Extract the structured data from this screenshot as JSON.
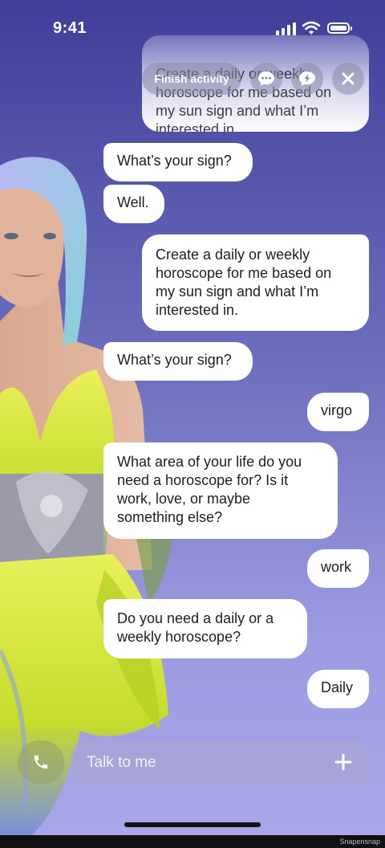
{
  "status_bar": {
    "time": "9:41"
  },
  "header": {
    "finish_label": "Finish activity",
    "icons": [
      "chat-bubble-icon",
      "lightning-bubble-icon",
      "close-icon"
    ],
    "faded_message": "Create a daily or weekly\nhoroscope for me based on\nmy sun sign and what I’m\ninterested in."
  },
  "messages": [
    {
      "sender": "bot",
      "text": "What’s your sign?"
    },
    {
      "sender": "bot",
      "text": "Well."
    },
    {
      "sender": "user",
      "text": "Create a daily or weekly\nhoroscope for me based on\nmy sun sign and what I’m\ninterested in."
    },
    {
      "sender": "bot",
      "text": "What’s your sign?"
    },
    {
      "sender": "user",
      "text": "virgo"
    },
    {
      "sender": "bot",
      "text": "What area of your life do you\nneed a horoscope for? Is it\nwork, love, or maybe\nsomething else?"
    },
    {
      "sender": "user",
      "text": "work"
    },
    {
      "sender": "bot",
      "text": "Do you need a daily or a\nweekly horoscope?"
    },
    {
      "sender": "user",
      "text": "Daily"
    }
  ],
  "composer": {
    "placeholder": "Talk to me",
    "value": "",
    "call_icon": "phone-icon",
    "add_icon": "plus-icon"
  },
  "footer": {
    "watermark": "Snapensnap"
  },
  "colors": {
    "bubble": "#ffffff",
    "text": "#1d1d24",
    "bg_top": "#3f3f9a",
    "bg_bottom": "#a9a6ea"
  }
}
